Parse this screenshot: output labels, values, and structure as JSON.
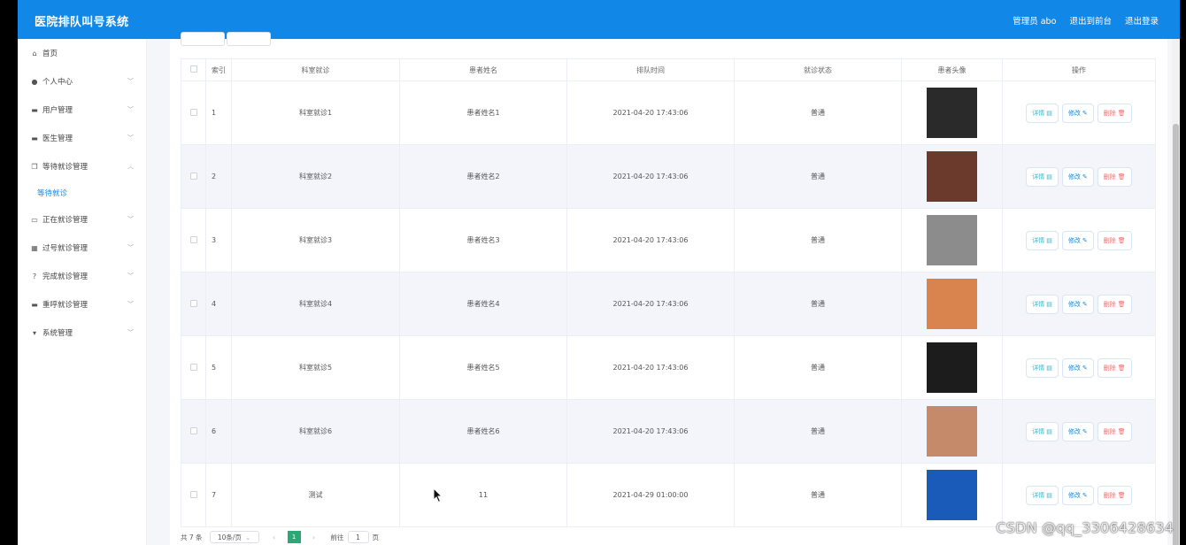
{
  "app": {
    "title": "医院排队叫号系统",
    "user_label": "管理员 abo",
    "front_link": "退出到前台",
    "logout_link": "退出登录"
  },
  "sidebar": {
    "items": [
      {
        "label": "首页",
        "icon": "home-icon",
        "glyph": "⌂"
      },
      {
        "label": "个人中心",
        "icon": "user-icon",
        "glyph": "●",
        "chevron": true
      },
      {
        "label": "用户管理",
        "icon": "monitor-icon",
        "glyph": "▬",
        "chevron": true
      },
      {
        "label": "医生管理",
        "icon": "monitor-icon",
        "glyph": "▬",
        "chevron": true
      },
      {
        "label": "等待就诊管理",
        "icon": "copy-icon",
        "glyph": "❐",
        "chevron": true,
        "expanded": true
      },
      {
        "label": "正在就诊管理",
        "icon": "chat-icon",
        "glyph": "▭",
        "chevron": true
      },
      {
        "label": "过号就诊管理",
        "icon": "grid-icon",
        "glyph": "▦",
        "chevron": true
      },
      {
        "label": "完成就诊管理",
        "icon": "help-icon",
        "glyph": "?",
        "chevron": true
      },
      {
        "label": "重呼就诊管理",
        "icon": "ticket-icon",
        "glyph": "▬",
        "chevron": true
      },
      {
        "label": "系统管理",
        "icon": "pin-icon",
        "glyph": "▾",
        "chevron": true
      }
    ],
    "active_sub": "等待就诊"
  },
  "table": {
    "headers": [
      "索引",
      "科室就诊",
      "患者姓名",
      "排队时间",
      "就诊状态",
      "患者头像",
      "操作"
    ],
    "rows": [
      {
        "index": "1",
        "dept": "科室就诊1",
        "name": "患者姓名1",
        "time": "2021-04-20 17:43:06",
        "status": "普通",
        "avatar_color": "#2a2a2a"
      },
      {
        "index": "2",
        "dept": "科室就诊2",
        "name": "患者姓名2",
        "time": "2021-04-20 17:43:06",
        "status": "普通",
        "avatar_color": "#6b3a2c"
      },
      {
        "index": "3",
        "dept": "科室就诊3",
        "name": "患者姓名3",
        "time": "2021-04-20 17:43:06",
        "status": "普通",
        "avatar_color": "#8c8c8c"
      },
      {
        "index": "4",
        "dept": "科室就诊4",
        "name": "患者姓名4",
        "time": "2021-04-20 17:43:06",
        "status": "普通",
        "avatar_color": "#d9834f"
      },
      {
        "index": "5",
        "dept": "科室就诊5",
        "name": "患者姓名5",
        "time": "2021-04-20 17:43:06",
        "status": "普通",
        "avatar_color": "#1c1c1c"
      },
      {
        "index": "6",
        "dept": "科室就诊6",
        "name": "患者姓名6",
        "time": "2021-04-20 17:43:06",
        "status": "普通",
        "avatar_color": "#c48a6a"
      },
      {
        "index": "7",
        "dept": "测试",
        "name": "11",
        "time": "2021-04-29 01:00:00",
        "status": "普通",
        "avatar_color": "#1a5ab8"
      }
    ],
    "actions": {
      "view": "详情",
      "edit": "修改",
      "delete": "删除"
    }
  },
  "pagination": {
    "total": "共 7 条",
    "page_size": "10条/页",
    "current_page": "1",
    "goto_label": "前往",
    "goto_value": "1",
    "page_suffix": "页"
  },
  "watermark": "CSDN @qq_3306428634"
}
